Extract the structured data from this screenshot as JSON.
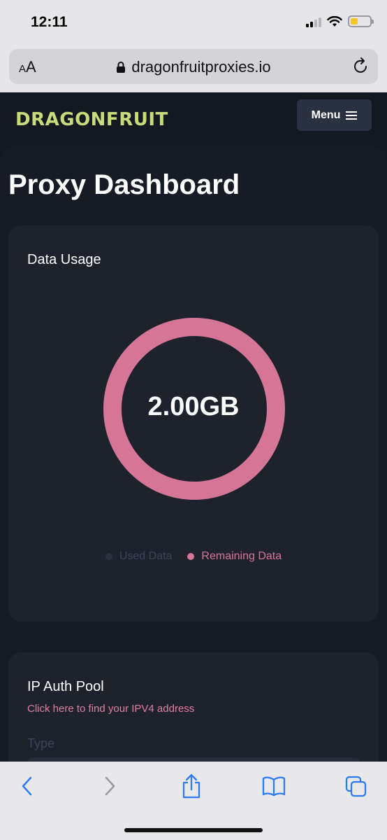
{
  "status_bar": {
    "time": "12:11"
  },
  "browser": {
    "text_size_label_small": "A",
    "text_size_label_large": "A",
    "url": "dragonfruitproxies.io"
  },
  "header": {
    "logo": "DRAGONFRUIT",
    "menu_label": "Menu"
  },
  "page": {
    "title": "Proxy Dashboard"
  },
  "data_usage": {
    "title": "Data Usage",
    "total_label": "2.00GB",
    "used_fraction": 0.0,
    "legend": [
      {
        "label": "Used Data",
        "color": "#2a3140"
      },
      {
        "label": "Remaining Data",
        "color": "#d67696"
      }
    ]
  },
  "ip_auth": {
    "title": "IP Auth Pool",
    "link_text": "Click here to find your IPV4 address",
    "type_label": "Type"
  },
  "colors": {
    "accent_pink": "#d67696",
    "logo_green": "#c8db7a",
    "ios_blue": "#2f7bf6"
  },
  "toolbar": {
    "icons": [
      "back-icon",
      "forward-icon",
      "share-icon",
      "bookmarks-icon",
      "tabs-icon"
    ]
  }
}
